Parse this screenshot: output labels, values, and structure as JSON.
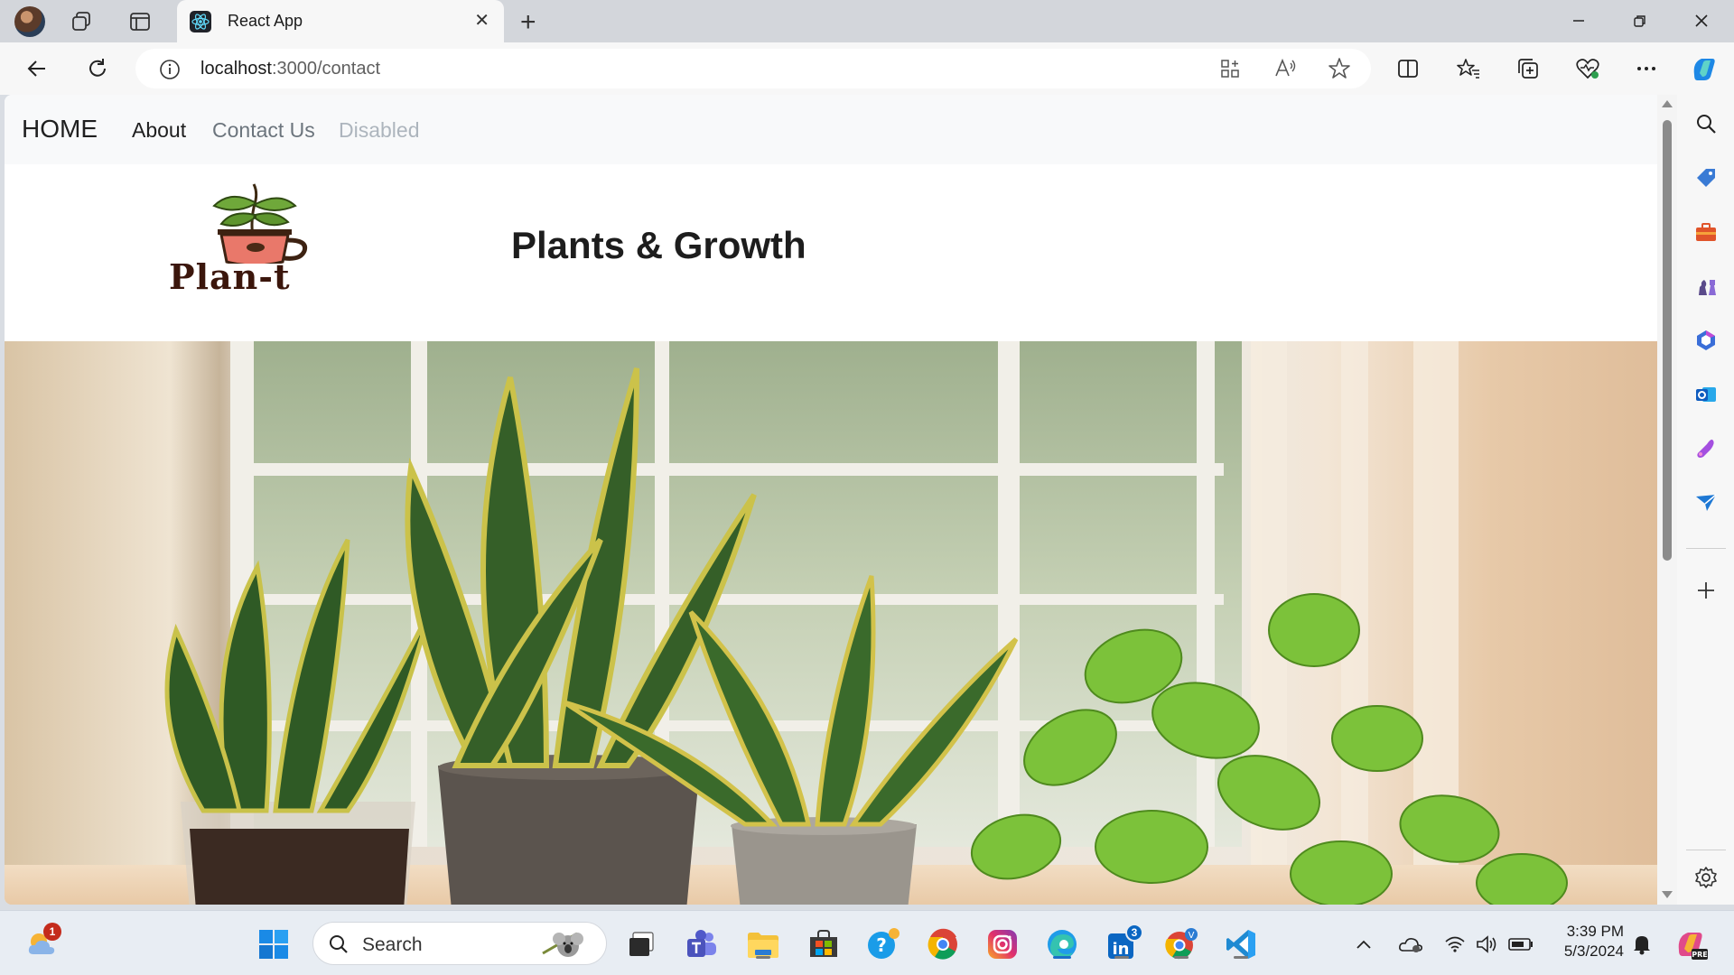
{
  "browser": {
    "tab_title": "React App",
    "url_host": "localhost",
    "url_path": ":3000/contact"
  },
  "navbar": {
    "brand": "HOME",
    "links": [
      "About",
      "Contact Us",
      "Disabled"
    ]
  },
  "header": {
    "logo_text": "Plan-t",
    "title": "Plants & Growth"
  },
  "taskbar": {
    "search_label": "Search",
    "time": "3:39 PM",
    "date": "5/3/2024",
    "weather_badge": "1",
    "linkedin_badge": "3"
  },
  "colors": {
    "nav_bg": "#f8f9fa",
    "link_active": "#1f1f1f",
    "link_muted": "#6c757d",
    "link_disabled": "#adb5bd"
  }
}
